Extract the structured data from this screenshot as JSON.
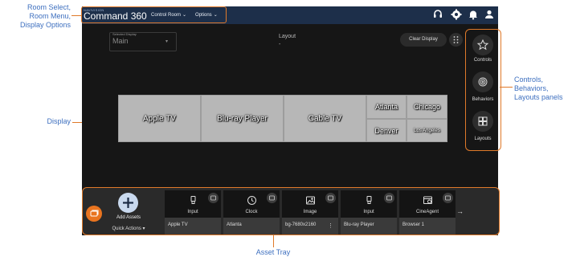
{
  "annotations": {
    "room": "Room Select,\nRoom Menu,\nDisplay Options",
    "display": "Display",
    "panels": "Controls,\nBehaviors,\nLayouts panels",
    "tray": "Asset Tray"
  },
  "header": {
    "brand_small": "NAVIVISION",
    "brand": "Command 360",
    "room_menu": "Control Room",
    "options_menu": "Options",
    "icons": [
      "headset-icon",
      "gear-icon",
      "bell-icon",
      "user-icon"
    ]
  },
  "toolbar": {
    "selected_display_label": "Selected Display",
    "selected_display_value": "Main",
    "layout_label": "Layout",
    "layout_value": "-",
    "clear_display": "Clear Display"
  },
  "display_wall": {
    "cells": [
      {
        "label": "Apple TV"
      },
      {
        "label": "Blu-ray Player"
      },
      {
        "label": "Cable TV"
      },
      {
        "label": "Atlanta"
      },
      {
        "label": "Chicago"
      },
      {
        "label": "Denver"
      },
      {
        "label": "Los Angeles"
      }
    ]
  },
  "side_panel": {
    "items": [
      {
        "label": "Controls",
        "icon": "controls-icon"
      },
      {
        "label": "Behaviors",
        "icon": "behaviors-icon"
      },
      {
        "label": "Layouts",
        "icon": "layouts-icon"
      }
    ]
  },
  "asset_tray": {
    "add_assets": "Add Assets",
    "quick_actions": "Quick Actions",
    "cards": [
      {
        "type": "Input",
        "name": "Apple TV",
        "icon": "input-icon"
      },
      {
        "type": "Clock",
        "name": "Atlanta",
        "icon": "clock-icon"
      },
      {
        "type": "Image",
        "name": "bg-7680x2160",
        "icon": "image-icon"
      },
      {
        "type": "Input",
        "name": "Blu-ray Player",
        "icon": "input-icon"
      },
      {
        "type": "CineAgent",
        "name": "Browser 1",
        "icon": "browser-icon"
      }
    ]
  },
  "colors": {
    "accent_orange": "#e07a2a",
    "header_bg": "#1d2f4a",
    "annotation_text": "#3d6fbf"
  }
}
